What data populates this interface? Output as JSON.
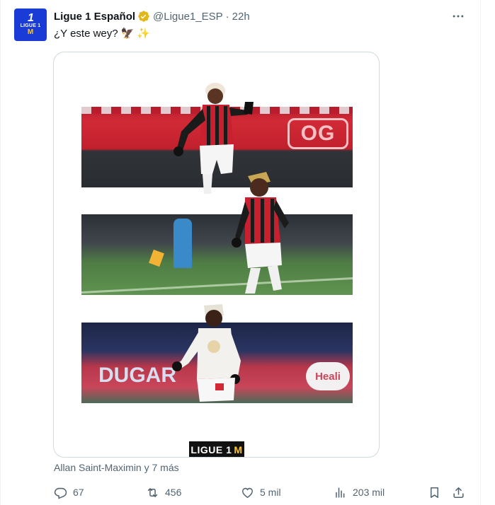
{
  "tweet": {
    "author": {
      "display_name": "Ligue 1 Español",
      "handle": "@Ligue1_ESP",
      "avatar_text": "LIGUE 1",
      "verified_icon": "gold-verified-badge-icon"
    },
    "separator": "·",
    "time": "22h",
    "text": "¿Y este wey?",
    "emojis": [
      "🦅",
      "✨"
    ],
    "media": {
      "brand_label": "LIGUE 1",
      "brand_mark": "M",
      "strip1_sign": "OG",
      "strip3_board": "DUGAR",
      "strip3_board2": "Heali"
    },
    "caption": "Allan Saint-Maximin y 7 más"
  },
  "actions": {
    "reply": {
      "icon": "reply-icon",
      "count": "67"
    },
    "retweet": {
      "icon": "retweet-icon",
      "count": "456"
    },
    "like": {
      "icon": "heart-icon",
      "count": "5 mil"
    },
    "views": {
      "icon": "views-chart-icon",
      "count": "203 mil"
    },
    "bookmark": {
      "icon": "bookmark-icon"
    },
    "share": {
      "icon": "share-icon"
    }
  },
  "colors": {
    "text_primary": "#0f1419",
    "text_secondary": "#536471",
    "border": "#cfd9de",
    "avatar_bg": "#1a3bd6",
    "verified_gold": "#e2b719"
  }
}
